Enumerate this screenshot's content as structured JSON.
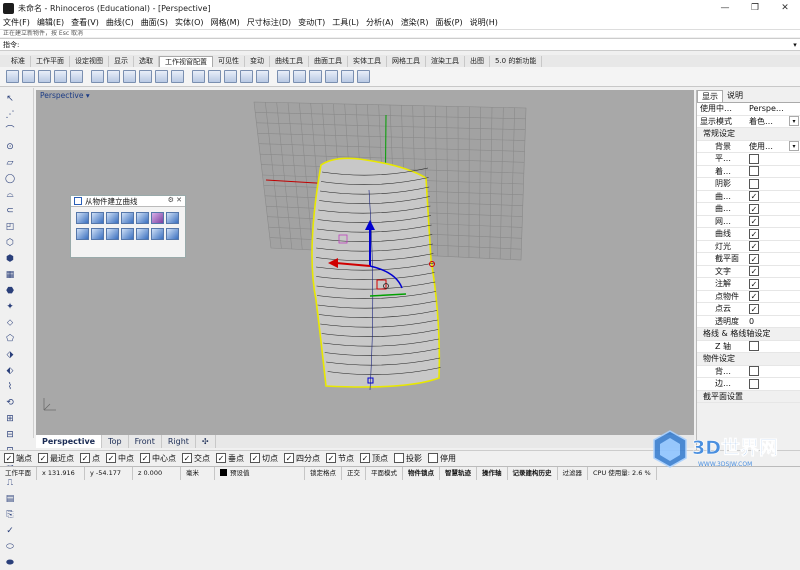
{
  "window": {
    "title": "未命名 - Rhinoceros (Educational) - [Perspective]",
    "controls": [
      "—",
      "❐",
      "✕"
    ]
  },
  "menu": [
    "文件(F)",
    "编辑(E)",
    "查看(V)",
    "曲线(C)",
    "曲面(S)",
    "实体(O)",
    "网格(M)",
    "尺寸标注(D)",
    "变动(T)",
    "工具(L)",
    "分析(A)",
    "渲染(R)",
    "面板(P)",
    "说明(H)"
  ],
  "command": {
    "history": "正在建立新物件，按 Esc 取消",
    "label": "指令:",
    "value": ""
  },
  "toolbar_tabs": [
    "标准",
    "工作平面",
    "设定视图",
    "显示",
    "选取",
    "工作视窗配置",
    "可见性",
    "变动",
    "曲线工具",
    "曲面工具",
    "实体工具",
    "网格工具",
    "渲染工具",
    "出图",
    "5.0 的新功能"
  ],
  "active_toolbar_tab": "工作视窗配置",
  "viewport": {
    "title": "Perspective",
    "background": "#a8a8a8"
  },
  "float_panel": {
    "title": "从物件建立曲线"
  },
  "viewport_tabs": [
    "Perspective",
    "Top",
    "Front",
    "Right",
    "✣"
  ],
  "osnap": [
    {
      "label": "端点",
      "checked": true
    },
    {
      "label": "最近点",
      "checked": true
    },
    {
      "label": "点",
      "checked": true
    },
    {
      "label": "中点",
      "checked": true
    },
    {
      "label": "中心点",
      "checked": true
    },
    {
      "label": "交点",
      "checked": true
    },
    {
      "label": "垂点",
      "checked": true
    },
    {
      "label": "切点",
      "checked": true
    },
    {
      "label": "四分点",
      "checked": true
    },
    {
      "label": "节点",
      "checked": true
    },
    {
      "label": "顶点",
      "checked": true
    },
    {
      "label": "投影",
      "checked": false
    },
    {
      "label": "停用",
      "checked": false
    }
  ],
  "status": {
    "cplane": "工作平面",
    "x": "x 131.916",
    "y": "y -54.177",
    "z": "z 0.000",
    "unit": "毫米",
    "layer": "预设值",
    "items": [
      "锁定格点",
      "正交",
      "平面模式",
      "物件锁点",
      "智慧轨迹",
      "操作轴",
      "记录建构历史",
      "过滤器"
    ],
    "cpu": "CPU 使用量: 2.6 %"
  },
  "right_panel": {
    "tabs": [
      "显示",
      "说明"
    ],
    "rows": [
      {
        "label": "使用中…",
        "value": "Perspe…",
        "type": "text"
      },
      {
        "label": "显示模式",
        "value": "着色…",
        "type": "dropdown"
      },
      {
        "label": "常规设定",
        "type": "section"
      },
      {
        "label": "背景",
        "value": "使用…",
        "type": "dropdown",
        "indent": true
      },
      {
        "label": "平…",
        "type": "check",
        "checked": false,
        "indent": true
      },
      {
        "label": "着…",
        "type": "check",
        "checked": false,
        "indent": true
      },
      {
        "label": "阴影",
        "type": "check",
        "checked": false,
        "indent": true
      },
      {
        "label": "曲…",
        "type": "check",
        "checked": true,
        "indent": true
      },
      {
        "label": "曲…",
        "type": "check",
        "checked": true,
        "indent": true
      },
      {
        "label": "网…",
        "type": "check",
        "checked": true,
        "indent": true
      },
      {
        "label": "曲线",
        "type": "check",
        "checked": true,
        "indent": true
      },
      {
        "label": "灯光",
        "type": "check",
        "checked": true,
        "indent": true
      },
      {
        "label": "截平面",
        "type": "check",
        "checked": true,
        "indent": true
      },
      {
        "label": "文字",
        "type": "check",
        "checked": true,
        "indent": true
      },
      {
        "label": "注解",
        "type": "check",
        "checked": true,
        "indent": true
      },
      {
        "label": "点物件",
        "type": "check",
        "checked": true,
        "indent": true
      },
      {
        "label": "点云",
        "type": "check",
        "checked": true,
        "indent": true
      },
      {
        "label": "透明度",
        "value": "0",
        "type": "text",
        "indent": true
      },
      {
        "label": "格线 & 格线轴设定",
        "type": "section"
      },
      {
        "label": "Z 轴",
        "type": "check",
        "checked": false,
        "indent": true
      },
      {
        "label": "物件设定",
        "type": "section"
      },
      {
        "label": "背…",
        "type": "check",
        "checked": false,
        "indent": true
      },
      {
        "label": "边…",
        "type": "check",
        "checked": false,
        "indent": true
      },
      {
        "label": "截平面设置",
        "type": "section"
      }
    ]
  },
  "watermark": {
    "brand": "3D世界网",
    "url": "WWW.3DSJW.COM"
  },
  "colors": {
    "x_axis": "#c00000",
    "y_axis": "#00a000",
    "z_axis": "#0000d0",
    "selection": "#e8e800",
    "grid": "#8a8a8a"
  }
}
